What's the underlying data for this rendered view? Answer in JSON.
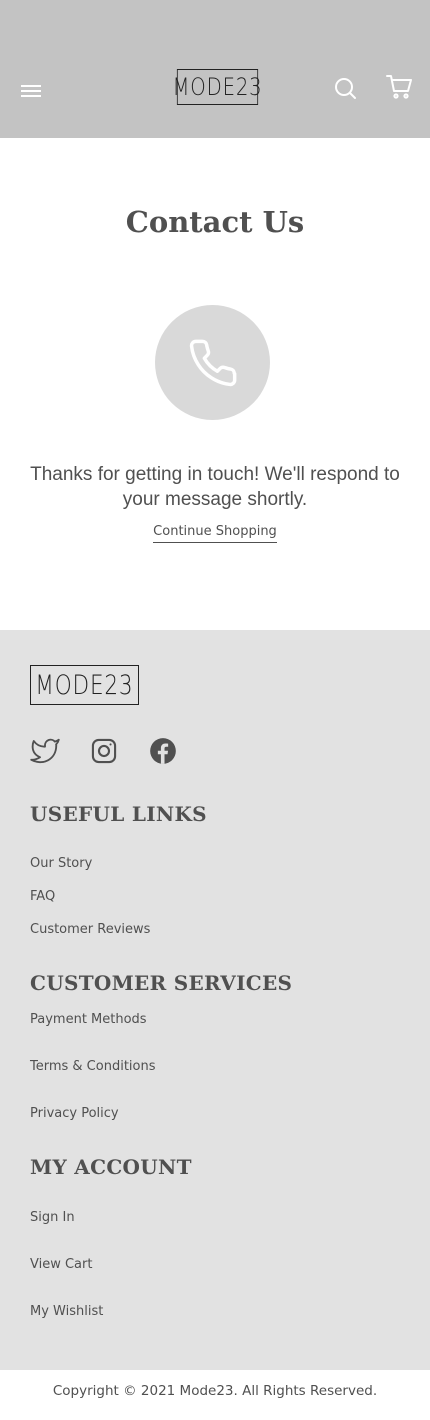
{
  "header": {
    "logo_text": "MODE23",
    "icons": {
      "menu": "hamburger-menu-icon",
      "search": "search-icon",
      "cart": "cart-icon"
    }
  },
  "main": {
    "title": "Contact Us",
    "icon": "phone-icon",
    "message": "Thanks for getting in touch! We'll respond to your message shortly.",
    "continue_label": "Continue Shopping"
  },
  "footer": {
    "logo_text": "MODE23",
    "social": [
      "twitter-icon",
      "instagram-icon",
      "facebook-icon"
    ],
    "useful_links": {
      "title": "USEFUL LINKS",
      "items": [
        "Our Story",
        "FAQ",
        "Customer Reviews"
      ]
    },
    "customer_services": {
      "title": "CUSTOMER SERVICES",
      "items": [
        "Payment Methods",
        "Terms & Conditions",
        "Privacy Policy"
      ]
    },
    "my_account": {
      "title": "MY ACCOUNT",
      "items": [
        "Sign In",
        "View Cart",
        "My Wishlist"
      ]
    }
  },
  "copyright": "Copyright © 2021 Mode23. All Rights Reserved.",
  "colors": {
    "header_bg": "#c3c3c3",
    "footer_bg": "#e2e2e2",
    "text": "#505050",
    "icon_circle": "#d9d9d9"
  }
}
